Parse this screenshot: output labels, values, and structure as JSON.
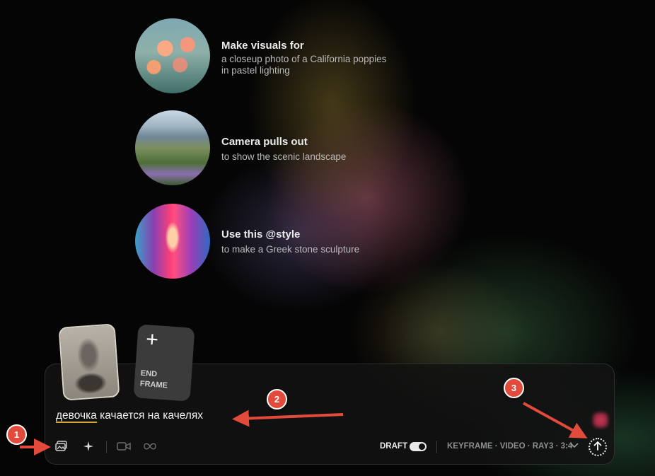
{
  "suggestions": [
    {
      "title": "Make visuals for",
      "description": "a closeup photo of a California poppies in pastel lighting"
    },
    {
      "title": "Camera pulls out",
      "description": "to show the scenic landscape"
    },
    {
      "title": "Use this @style",
      "description": "to make a Greek stone sculpture"
    }
  ],
  "attachments": {
    "end_frame_label_1": "END",
    "end_frame_label_2": "FRAME",
    "plus_glyph": "+"
  },
  "composer": {
    "prompt_underlined": "девочка",
    "prompt_rest": " качается на качелях",
    "draft_label": "DRAFT",
    "draft_enabled": true,
    "settings_label": "KEYFRAME · VIDEO · RAY3 · 3:4"
  },
  "icons": {
    "image": "image-icon",
    "sparkle": "sparkle-icon",
    "video": "video-camera-icon",
    "loop": "infinity-icon",
    "chevron": "chevron-down-icon",
    "submit": "arrow-up-icon"
  },
  "annotations": {
    "badge_1": "1",
    "badge_2": "2",
    "badge_3": "3",
    "color": "#e24a3b"
  }
}
